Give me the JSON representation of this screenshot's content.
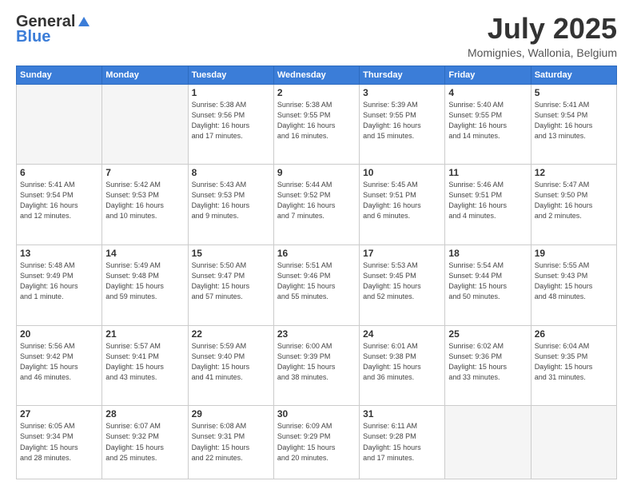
{
  "header": {
    "logo_general": "General",
    "logo_blue": "Blue",
    "month": "July 2025",
    "location": "Momignies, Wallonia, Belgium"
  },
  "weekdays": [
    "Sunday",
    "Monday",
    "Tuesday",
    "Wednesday",
    "Thursday",
    "Friday",
    "Saturday"
  ],
  "weeks": [
    [
      {
        "day": "",
        "info": ""
      },
      {
        "day": "",
        "info": ""
      },
      {
        "day": "1",
        "info": "Sunrise: 5:38 AM\nSunset: 9:56 PM\nDaylight: 16 hours\nand 17 minutes."
      },
      {
        "day": "2",
        "info": "Sunrise: 5:38 AM\nSunset: 9:55 PM\nDaylight: 16 hours\nand 16 minutes."
      },
      {
        "day": "3",
        "info": "Sunrise: 5:39 AM\nSunset: 9:55 PM\nDaylight: 16 hours\nand 15 minutes."
      },
      {
        "day": "4",
        "info": "Sunrise: 5:40 AM\nSunset: 9:55 PM\nDaylight: 16 hours\nand 14 minutes."
      },
      {
        "day": "5",
        "info": "Sunrise: 5:41 AM\nSunset: 9:54 PM\nDaylight: 16 hours\nand 13 minutes."
      }
    ],
    [
      {
        "day": "6",
        "info": "Sunrise: 5:41 AM\nSunset: 9:54 PM\nDaylight: 16 hours\nand 12 minutes."
      },
      {
        "day": "7",
        "info": "Sunrise: 5:42 AM\nSunset: 9:53 PM\nDaylight: 16 hours\nand 10 minutes."
      },
      {
        "day": "8",
        "info": "Sunrise: 5:43 AM\nSunset: 9:53 PM\nDaylight: 16 hours\nand 9 minutes."
      },
      {
        "day": "9",
        "info": "Sunrise: 5:44 AM\nSunset: 9:52 PM\nDaylight: 16 hours\nand 7 minutes."
      },
      {
        "day": "10",
        "info": "Sunrise: 5:45 AM\nSunset: 9:51 PM\nDaylight: 16 hours\nand 6 minutes."
      },
      {
        "day": "11",
        "info": "Sunrise: 5:46 AM\nSunset: 9:51 PM\nDaylight: 16 hours\nand 4 minutes."
      },
      {
        "day": "12",
        "info": "Sunrise: 5:47 AM\nSunset: 9:50 PM\nDaylight: 16 hours\nand 2 minutes."
      }
    ],
    [
      {
        "day": "13",
        "info": "Sunrise: 5:48 AM\nSunset: 9:49 PM\nDaylight: 16 hours\nand 1 minute."
      },
      {
        "day": "14",
        "info": "Sunrise: 5:49 AM\nSunset: 9:48 PM\nDaylight: 15 hours\nand 59 minutes."
      },
      {
        "day": "15",
        "info": "Sunrise: 5:50 AM\nSunset: 9:47 PM\nDaylight: 15 hours\nand 57 minutes."
      },
      {
        "day": "16",
        "info": "Sunrise: 5:51 AM\nSunset: 9:46 PM\nDaylight: 15 hours\nand 55 minutes."
      },
      {
        "day": "17",
        "info": "Sunrise: 5:53 AM\nSunset: 9:45 PM\nDaylight: 15 hours\nand 52 minutes."
      },
      {
        "day": "18",
        "info": "Sunrise: 5:54 AM\nSunset: 9:44 PM\nDaylight: 15 hours\nand 50 minutes."
      },
      {
        "day": "19",
        "info": "Sunrise: 5:55 AM\nSunset: 9:43 PM\nDaylight: 15 hours\nand 48 minutes."
      }
    ],
    [
      {
        "day": "20",
        "info": "Sunrise: 5:56 AM\nSunset: 9:42 PM\nDaylight: 15 hours\nand 46 minutes."
      },
      {
        "day": "21",
        "info": "Sunrise: 5:57 AM\nSunset: 9:41 PM\nDaylight: 15 hours\nand 43 minutes."
      },
      {
        "day": "22",
        "info": "Sunrise: 5:59 AM\nSunset: 9:40 PM\nDaylight: 15 hours\nand 41 minutes."
      },
      {
        "day": "23",
        "info": "Sunrise: 6:00 AM\nSunset: 9:39 PM\nDaylight: 15 hours\nand 38 minutes."
      },
      {
        "day": "24",
        "info": "Sunrise: 6:01 AM\nSunset: 9:38 PM\nDaylight: 15 hours\nand 36 minutes."
      },
      {
        "day": "25",
        "info": "Sunrise: 6:02 AM\nSunset: 9:36 PM\nDaylight: 15 hours\nand 33 minutes."
      },
      {
        "day": "26",
        "info": "Sunrise: 6:04 AM\nSunset: 9:35 PM\nDaylight: 15 hours\nand 31 minutes."
      }
    ],
    [
      {
        "day": "27",
        "info": "Sunrise: 6:05 AM\nSunset: 9:34 PM\nDaylight: 15 hours\nand 28 minutes."
      },
      {
        "day": "28",
        "info": "Sunrise: 6:07 AM\nSunset: 9:32 PM\nDaylight: 15 hours\nand 25 minutes."
      },
      {
        "day": "29",
        "info": "Sunrise: 6:08 AM\nSunset: 9:31 PM\nDaylight: 15 hours\nand 22 minutes."
      },
      {
        "day": "30",
        "info": "Sunrise: 6:09 AM\nSunset: 9:29 PM\nDaylight: 15 hours\nand 20 minutes."
      },
      {
        "day": "31",
        "info": "Sunrise: 6:11 AM\nSunset: 9:28 PM\nDaylight: 15 hours\nand 17 minutes."
      },
      {
        "day": "",
        "info": ""
      },
      {
        "day": "",
        "info": ""
      }
    ]
  ]
}
